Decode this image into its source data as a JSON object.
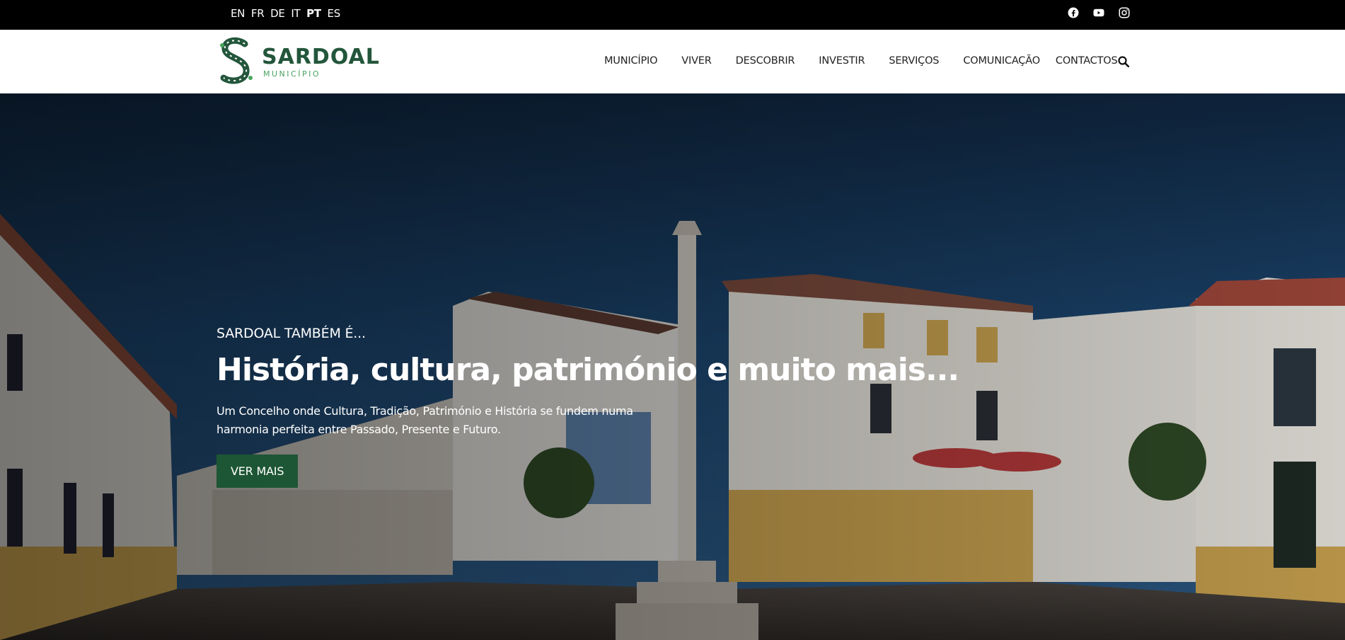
{
  "languages": [
    {
      "code": "EN",
      "active": false
    },
    {
      "code": "FR",
      "active": false
    },
    {
      "code": "DE",
      "active": false
    },
    {
      "code": "IT",
      "active": false
    },
    {
      "code": "PT",
      "active": true
    },
    {
      "code": "ES",
      "active": false
    }
  ],
  "social": [
    "facebook-icon",
    "youtube-icon",
    "instagram-icon"
  ],
  "logo": {
    "title": "SARDOAL",
    "subtitle": "MUNICÍPIO"
  },
  "nav": {
    "items": [
      "MUNICÍPIO",
      "VIVER",
      "DESCOBRIR",
      "INVESTIR",
      "SERVIÇOS",
      "COMUNICAÇÃO",
      "CONTACTOS"
    ],
    "search_icon": "search-icon"
  },
  "hero": {
    "pre_title": "SARDOAL TAMBÉM É...",
    "title": "História, cultura, património e muito mais...",
    "description": "Um Concelho onde Cultura, Tradição, Património e História se fundem numa harmonia perfeita entre Passado, Presente e Futuro.",
    "button": "VER MAIS"
  },
  "colors": {
    "brand_green": "#1d5634",
    "logo_green": "#23563b",
    "accent_green": "#49a35d",
    "topbar": "#000000"
  }
}
